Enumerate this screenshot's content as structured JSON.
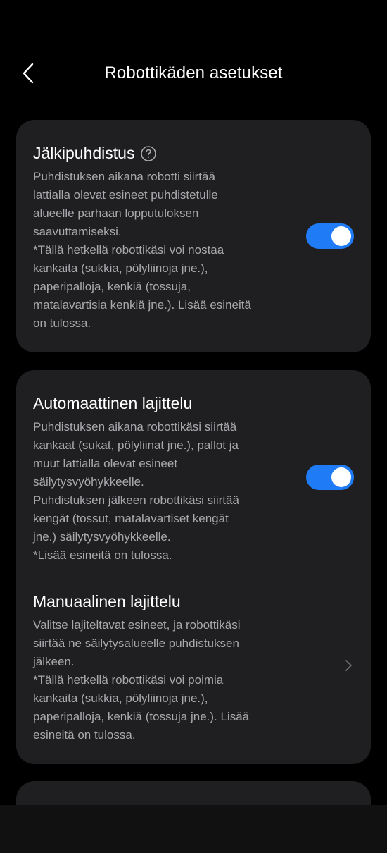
{
  "header": {
    "title": "Robottikäden asetukset",
    "back_icon": "chevron-left-icon"
  },
  "cards": [
    {
      "rows": [
        {
          "title": "Jälkipuhdistus",
          "help_icon": "question-circle-icon",
          "description": "Puhdistuksen aikana robotti siirtää lattialla olevat esineet puhdistetulle alueelle parhaan lopputuloksen saavuttamiseksi.\n*Tällä hetkellä robottikäsi voi nostaa kankaita (sukkia, pölyliinoja jne.), paperipalloja, kenkiä (tossuja, matalavartisia kenkiä jne.). Lisää esineitä on tulossa.",
          "toggle_on": true
        }
      ]
    },
    {
      "rows": [
        {
          "title": "Automaattinen lajittelu",
          "description": "Puhdistuksen aikana robottikäsi siirtää kankaat (sukat, pölyliinat jne.), pallot ja muut lattialla olevat esineet säilytysvyöhykkeelle.\nPuhdistuksen jälkeen robottikäsi siirtää kengät (tossut, matalavartiset kengät jne.) säilytysvyöhykkeelle.\n*Lisää esineitä on tulossa.",
          "toggle_on": true
        },
        {
          "title": "Manuaalinen lajittelu",
          "description": "Valitse lajiteltavat esineet, ja robottikäsi siirtää ne säilytysalueelle puhdistuksen jälkeen.\n*Tällä hetkellä robottikäsi voi poimia kankaita (sukkia, pölyliinoja jne.), paperipalloja, kenkiä (tossuja jne.). Lisää esineitä on tulossa.",
          "chevron_icon": "chevron-right-icon"
        }
      ]
    }
  ],
  "colors": {
    "background": "#000000",
    "card": "#1f1f21",
    "toggle_on": "#1f7cf6",
    "text_primary": "#ffffff",
    "text_secondary": "#a9a9ad"
  }
}
